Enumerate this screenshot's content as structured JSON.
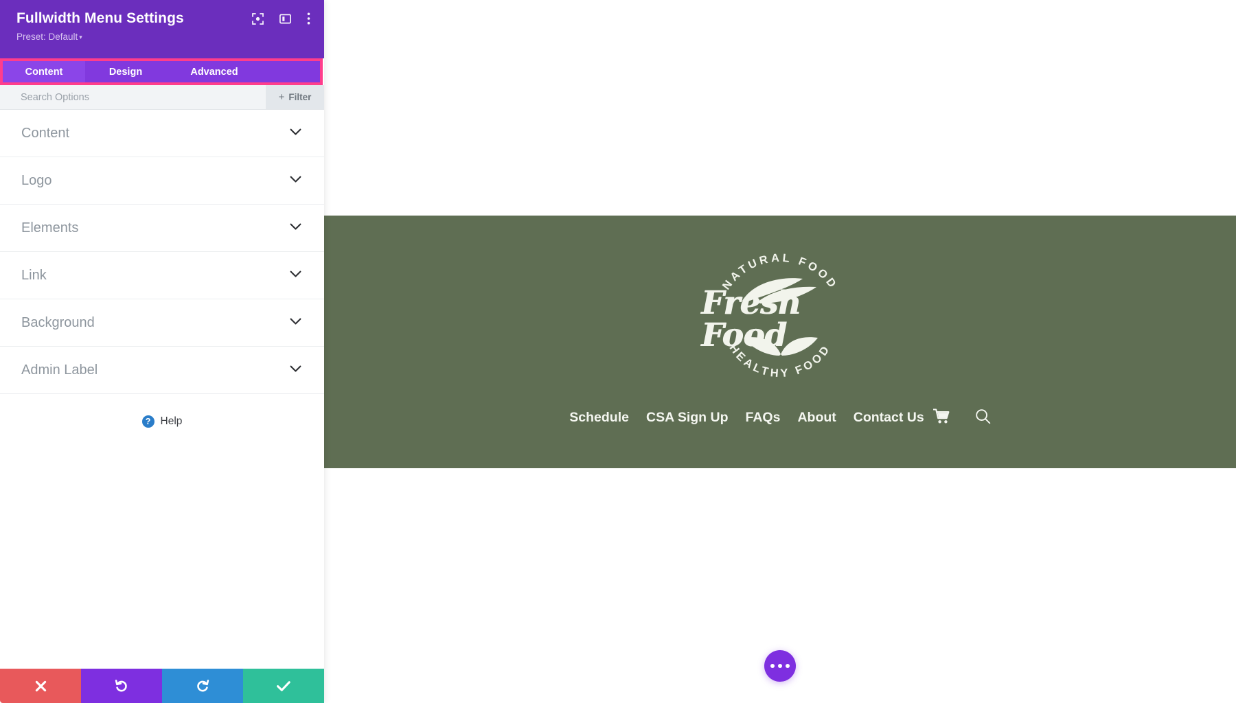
{
  "panel": {
    "title": "Fullwidth Menu Settings",
    "preset_label": "Preset: Default",
    "preset_caret": "▾",
    "header_icons": [
      {
        "name": "focus-icon",
        "label": "Focus"
      },
      {
        "name": "layout-panel-icon",
        "label": "Panel Layout"
      },
      {
        "name": "more-vertical-icon",
        "label": "More Options"
      }
    ],
    "tabs": [
      {
        "label": "Content",
        "active": true
      },
      {
        "label": "Design",
        "active": false
      },
      {
        "label": "Advanced",
        "active": false
      }
    ],
    "search": {
      "placeholder": "Search Options",
      "value": ""
    },
    "filter": {
      "label": "Filter",
      "plus": "+"
    },
    "sections": [
      {
        "label": "Content"
      },
      {
        "label": "Logo"
      },
      {
        "label": "Elements"
      },
      {
        "label": "Link"
      },
      {
        "label": "Background"
      },
      {
        "label": "Admin Label"
      }
    ],
    "help": {
      "label": "Help",
      "glyph": "?"
    },
    "actions": [
      {
        "name": "close",
        "glyph": "✕",
        "color": "#E8595B"
      },
      {
        "name": "undo",
        "glyph": "↺",
        "color": "#7E2FE0"
      },
      {
        "name": "redo",
        "glyph": "↻",
        "color": "#2E8ED6"
      },
      {
        "name": "save",
        "glyph": "✓",
        "color": "#2FC09A"
      }
    ],
    "colors": {
      "header_purple": "#6B2EBD",
      "tabbar_purple": "#8139DE",
      "tab_active": "#8B45E8",
      "highlight_pink": "#FF3D8C"
    }
  },
  "preview": {
    "logo": {
      "arc_top": "NATURAL FOOD",
      "arc_bottom": "HEALTHY FOOD",
      "wordmark": "Fresh Food"
    },
    "nav": [
      {
        "label": "Schedule"
      },
      {
        "label": "CSA Sign Up"
      },
      {
        "label": "FAQs"
      },
      {
        "label": "About"
      },
      {
        "label": "Contact Us"
      }
    ],
    "nav_icons": [
      {
        "name": "cart-icon"
      },
      {
        "name": "search-icon"
      }
    ],
    "colors": {
      "header_green": "#5F6E53",
      "text_cream": "#F4F6F0"
    },
    "fab": {
      "name": "settings-fab",
      "dots": 3,
      "color": "#7E2FE0"
    }
  }
}
